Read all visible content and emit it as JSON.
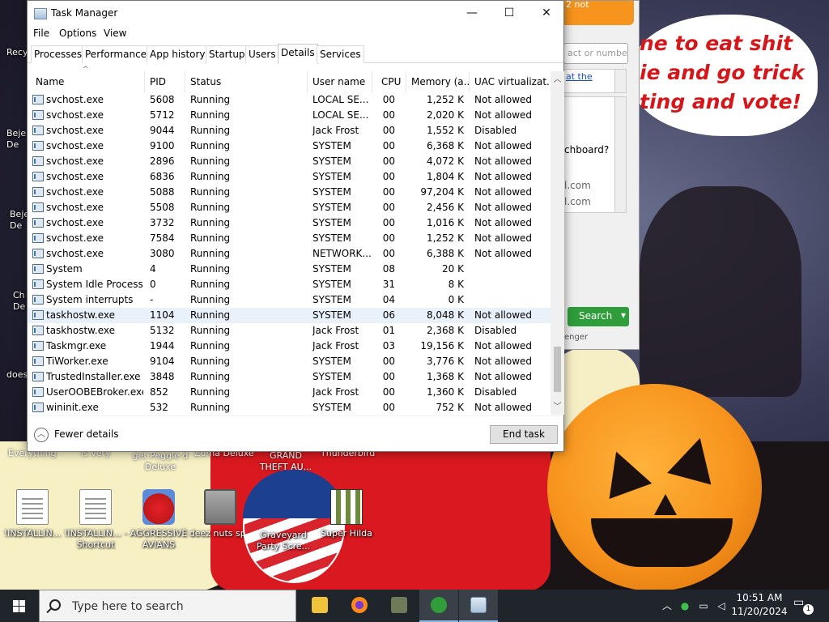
{
  "window": {
    "title": "Task Manager",
    "minimize": "—",
    "maximize": "☐",
    "close": "✕"
  },
  "menu": [
    "File",
    "Options",
    "View"
  ],
  "tabs": [
    "Processes",
    "Performance",
    "App history",
    "Startup",
    "Users",
    "Details",
    "Services"
  ],
  "active_tab": "Details",
  "columns": [
    "Name",
    "PID",
    "Status",
    "User name",
    "CPU",
    "Memory (a...",
    "UAC virtualizat..."
  ],
  "rows": [
    {
      "name": "svchost.exe",
      "pid": "5608",
      "status": "Running",
      "user": "LOCAL SE...",
      "cpu": "00",
      "mem": "1,252 K",
      "uac": "Not allowed"
    },
    {
      "name": "svchost.exe",
      "pid": "5712",
      "status": "Running",
      "user": "LOCAL SE...",
      "cpu": "00",
      "mem": "2,020 K",
      "uac": "Not allowed"
    },
    {
      "name": "svchost.exe",
      "pid": "9044",
      "status": "Running",
      "user": "Jack Frost",
      "cpu": "00",
      "mem": "1,552 K",
      "uac": "Disabled"
    },
    {
      "name": "svchost.exe",
      "pid": "9100",
      "status": "Running",
      "user": "SYSTEM",
      "cpu": "00",
      "mem": "6,368 K",
      "uac": "Not allowed"
    },
    {
      "name": "svchost.exe",
      "pid": "2896",
      "status": "Running",
      "user": "SYSTEM",
      "cpu": "00",
      "mem": "4,072 K",
      "uac": "Not allowed"
    },
    {
      "name": "svchost.exe",
      "pid": "6836",
      "status": "Running",
      "user": "SYSTEM",
      "cpu": "00",
      "mem": "1,804 K",
      "uac": "Not allowed"
    },
    {
      "name": "svchost.exe",
      "pid": "5088",
      "status": "Running",
      "user": "SYSTEM",
      "cpu": "00",
      "mem": "97,204 K",
      "uac": "Not allowed"
    },
    {
      "name": "svchost.exe",
      "pid": "5508",
      "status": "Running",
      "user": "SYSTEM",
      "cpu": "00",
      "mem": "2,456 K",
      "uac": "Not allowed"
    },
    {
      "name": "svchost.exe",
      "pid": "3732",
      "status": "Running",
      "user": "SYSTEM",
      "cpu": "00",
      "mem": "1,016 K",
      "uac": "Not allowed"
    },
    {
      "name": "svchost.exe",
      "pid": "7584",
      "status": "Running",
      "user": "SYSTEM",
      "cpu": "00",
      "mem": "1,252 K",
      "uac": "Not allowed"
    },
    {
      "name": "svchost.exe",
      "pid": "3080",
      "status": "Running",
      "user": "NETWORK...",
      "cpu": "00",
      "mem": "6,388 K",
      "uac": "Not allowed"
    },
    {
      "name": "System",
      "pid": "4",
      "status": "Running",
      "user": "SYSTEM",
      "cpu": "08",
      "mem": "20 K",
      "uac": ""
    },
    {
      "name": "System Idle Process",
      "pid": "0",
      "status": "Running",
      "user": "SYSTEM",
      "cpu": "31",
      "mem": "8 K",
      "uac": ""
    },
    {
      "name": "System interrupts",
      "pid": "-",
      "status": "Running",
      "user": "SYSTEM",
      "cpu": "04",
      "mem": "0 K",
      "uac": ""
    },
    {
      "name": "taskhostw.exe",
      "pid": "1104",
      "status": "Running",
      "user": "SYSTEM",
      "cpu": "06",
      "mem": "8,048 K",
      "uac": "Not allowed"
    },
    {
      "name": "taskhostw.exe",
      "pid": "5132",
      "status": "Running",
      "user": "Jack Frost",
      "cpu": "01",
      "mem": "2,368 K",
      "uac": "Disabled"
    },
    {
      "name": "Taskmgr.exe",
      "pid": "1944",
      "status": "Running",
      "user": "Jack Frost",
      "cpu": "03",
      "mem": "19,156 K",
      "uac": "Not allowed"
    },
    {
      "name": "TiWorker.exe",
      "pid": "9104",
      "status": "Running",
      "user": "SYSTEM",
      "cpu": "00",
      "mem": "3,776 K",
      "uac": "Not allowed"
    },
    {
      "name": "TrustedInstaller.exe",
      "pid": "3848",
      "status": "Running",
      "user": "SYSTEM",
      "cpu": "00",
      "mem": "1,368 K",
      "uac": "Not allowed"
    },
    {
      "name": "UserOOBEBroker.exe",
      "pid": "852",
      "status": "Running",
      "user": "Jack Frost",
      "cpu": "00",
      "mem": "1,360 K",
      "uac": "Disabled"
    },
    {
      "name": "wininit.exe",
      "pid": "532",
      "status": "Running",
      "user": "SYSTEM",
      "cpu": "00",
      "mem": "752 K",
      "uac": "Not allowed"
    }
  ],
  "highlighted_row": 14,
  "footer": {
    "fewer_details": "Fewer details",
    "end_task": "End task"
  },
  "background_app": {
    "top_text": "2 not",
    "search_placeholder": "act or numbe",
    "link_text": "at the",
    "line1": "chboard?",
    "line2": "l.com",
    "line3": "l.com",
    "search_button": "Search",
    "footer_text": "enger"
  },
  "wallpaper_text": {
    "line1": "ne to eat shit",
    "line2": "ie and go trick",
    "line3": "ting and vote!"
  },
  "desktop_icons": [
    {
      "label": "!INSTALLIN...",
      "icon": "document-icon"
    },
    {
      "label": "!INSTALLIN... - Shortcut",
      "icon": "document-shortcut-icon"
    },
    {
      "label": "AGGRESSIVE AVIANS",
      "icon": "angry-bird-icon"
    },
    {
      "label": "deez nuts spy",
      "icon": "screens-icon"
    },
    {
      "label": "Graveyard Party Scre...",
      "icon": "vote-badge-icon"
    },
    {
      "label": "Super Hilda",
      "icon": "pixel-art-icon"
    }
  ],
  "partial_labels": {
    "left_top": [
      "Recy",
      "Beje De",
      "Beje De",
      "Ch De",
      "does"
    ],
    "everything": "Everything",
    "is_very": "is very",
    "get_peggle": "get Peggle d Deluxe",
    "zuma": "Zuma Deluxe",
    "gta": "GRAND THEFT AU...",
    "thunderbird": "Thunderbird"
  },
  "taskbar": {
    "search_placeholder": "Type here to search",
    "time": "10:51 AM",
    "date": "11/20/2024",
    "notification_count": "1"
  }
}
